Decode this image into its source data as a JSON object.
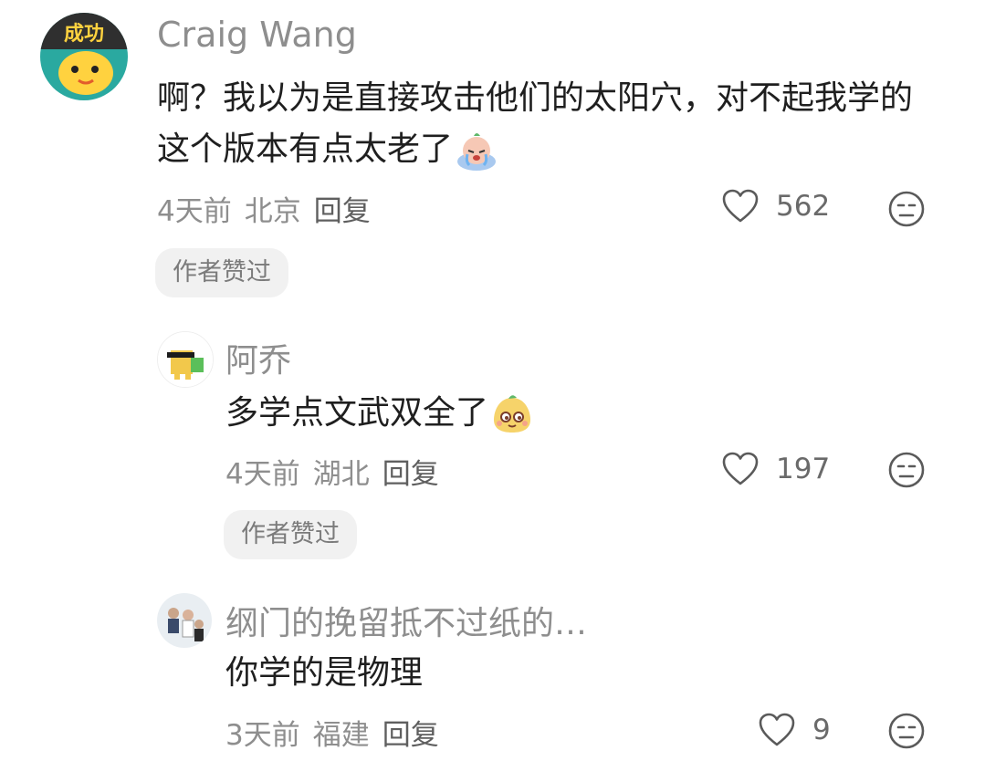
{
  "comments": [
    {
      "username": "Craig Wang",
      "text": "啊？我以为是直接攻击他们的太阳穴，对不起我学的这个版本有点太老了",
      "emoji": "crying-face-emoji",
      "time": "4天前",
      "location": "北京",
      "reply_label": "回复",
      "likes": "562",
      "badge": "作者赞过"
    },
    {
      "username": "阿乔",
      "text": "多学点文武双全了",
      "emoji": "smug-face-emoji",
      "time": "4天前",
      "location": "湖北",
      "reply_label": "回复",
      "likes": "197",
      "badge": "作者赞过"
    },
    {
      "username": "纲门的挽留抵不过纸的…",
      "text": "你学的是物理",
      "time": "3天前",
      "location": "福建",
      "reply_label": "回复",
      "likes": "9"
    }
  ],
  "colors": {
    "text_primary": "#1f1f1f",
    "text_secondary": "#8e8e8e",
    "badge_bg": "#f1f1f1"
  },
  "icons": [
    "heart-outline-icon",
    "dislike-face-icon"
  ]
}
